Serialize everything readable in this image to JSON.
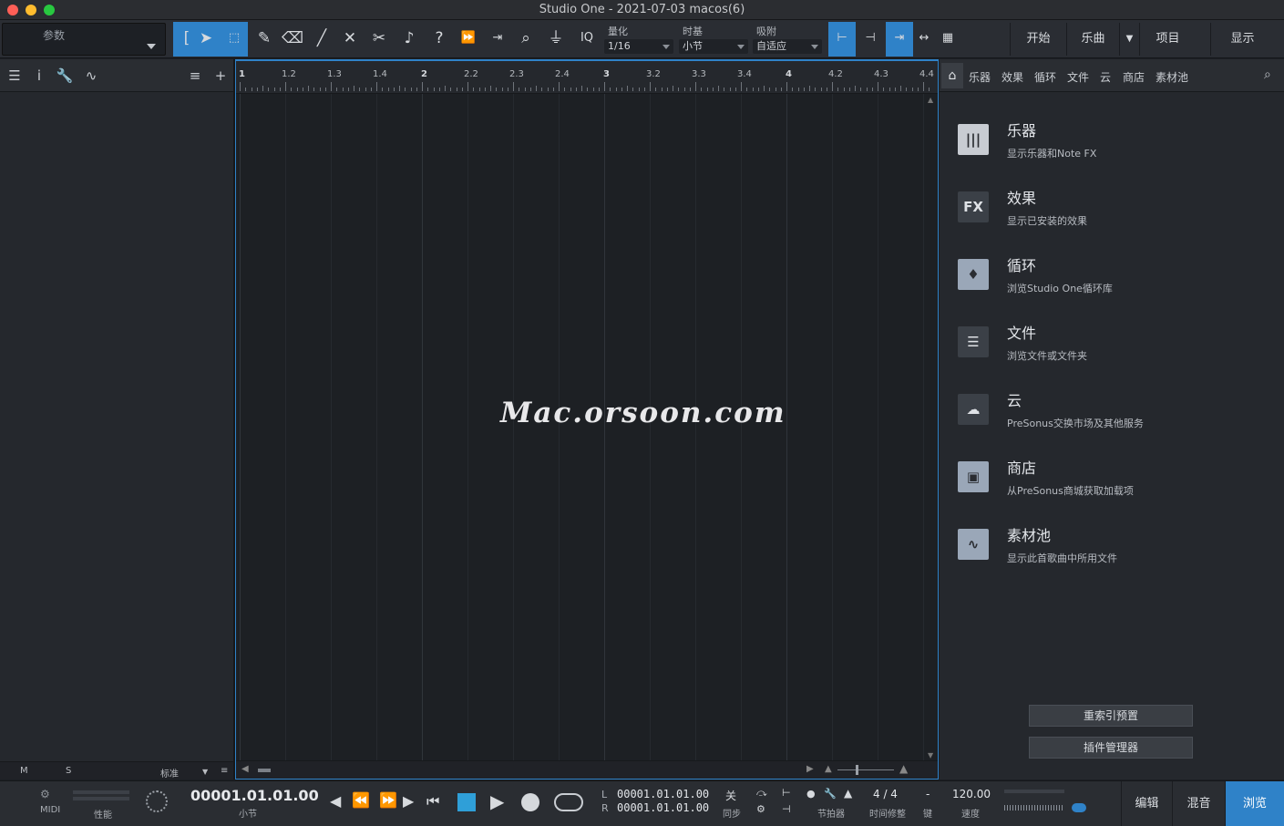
{
  "window": {
    "title": "Studio One - 2021-07-03 macos(6)"
  },
  "toolbar": {
    "param_label": "参数",
    "iq_label": "IQ",
    "quantize": {
      "caption": "量化",
      "value": "1/16"
    },
    "timebase": {
      "caption": "时基",
      "value": "小节"
    },
    "snap": {
      "caption": "吸附",
      "value": "自适应"
    },
    "page_buttons": [
      "开始",
      "乐曲",
      "项目",
      "显示"
    ]
  },
  "ruler": {
    "labels": [
      "1",
      "1.2",
      "1.3",
      "1.4",
      "2",
      "2.2",
      "2.3",
      "2.4",
      "3",
      "3.2",
      "3.3",
      "3.4",
      "4",
      "4.2",
      "4.3",
      "4.4"
    ]
  },
  "arrange": {
    "watermark": "Mac.orsoon.com"
  },
  "left_panel": {
    "footer": {
      "m": "M",
      "s": "S",
      "mode": "标准"
    }
  },
  "browser": {
    "tabs": [
      "乐器",
      "效果",
      "循环",
      "文件",
      "云",
      "商店",
      "素材池"
    ],
    "items": [
      {
        "name": "乐器",
        "desc": "显示乐器和Note FX",
        "icon": "piano-icon"
      },
      {
        "name": "效果",
        "desc": "显示已安装的效果",
        "icon": "fx-icon",
        "icon_text": "FX"
      },
      {
        "name": "循环",
        "desc": "浏览Studio One循环库",
        "icon": "loop-icon"
      },
      {
        "name": "文件",
        "desc": "浏览文件或文件夹",
        "icon": "file-list-icon"
      },
      {
        "name": "云",
        "desc": "PreSonus交换市场及其他服务",
        "icon": "cloud-icon"
      },
      {
        "name": "商店",
        "desc": "从PreSonus商城获取加载项",
        "icon": "shop-bag-icon"
      },
      {
        "name": "素材池",
        "desc": "显示此首歌曲中所用文件",
        "icon": "pool-waveform-icon"
      }
    ],
    "buttons": {
      "reindex": "重索引预置",
      "plugin_manager": "插件管理器"
    }
  },
  "transport": {
    "midi": "MIDI",
    "performance": "性能",
    "position": "00001.01.01.00",
    "position_unit": "小节",
    "loop_l_label": "L",
    "loop_r_label": "R",
    "loop_l": "00001.01.01.00",
    "loop_r": "00001.01.01.00",
    "sync_value": "关",
    "sync_label": "同步",
    "metronome_label": "节拍器",
    "time_sig": "4 / 4",
    "time_sig_label": "时间修整",
    "key_value": "-",
    "key_label": "键",
    "tempo": "120.00",
    "tempo_label": "速度",
    "views": [
      "编辑",
      "混音",
      "浏览"
    ]
  },
  "colors": {
    "accent": "#2f82c8",
    "background": "#1d2024",
    "panel": "#25282d"
  }
}
